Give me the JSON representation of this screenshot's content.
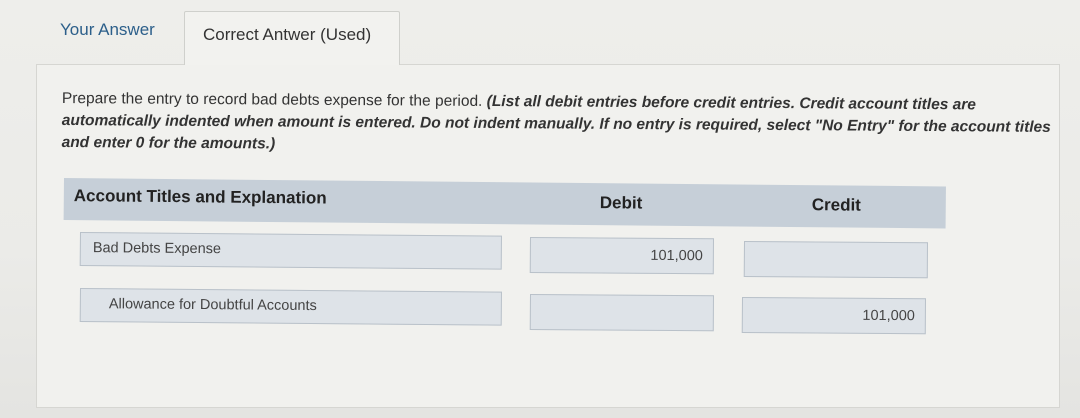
{
  "tabs": [
    {
      "label": "Your Answer"
    },
    {
      "label": "Correct Antwer (Used)"
    }
  ],
  "instructions": {
    "lead": "Prepare the entry to record bad debts expense for the period.",
    "note": "(List all debit entries before credit entries. Credit account titles are automatically indented when amount is entered. Do not indent manually. If no entry is required, select \"No Entry\" for the account titles and enter 0 for the amounts.)"
  },
  "table": {
    "headers": {
      "account": "Account Titles and Explanation",
      "debit": "Debit",
      "credit": "Credit"
    },
    "rows": [
      {
        "account": "Bad Debts Expense",
        "debit": "101,000",
        "credit": ""
      },
      {
        "account": "Allowance for Doubtful Accounts",
        "debit": "",
        "credit": "101,000"
      }
    ]
  }
}
